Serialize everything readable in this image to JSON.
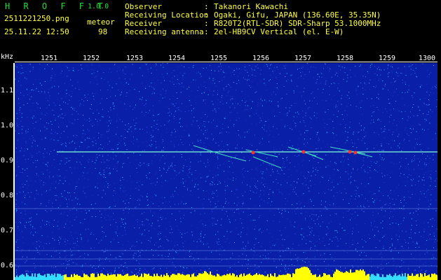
{
  "header": {
    "brand": "H R O F F T",
    "version": "1.0.0",
    "filename": "2511221250.png",
    "detector_label": "meteor",
    "datetime": "25.11.22 12:50",
    "meteor_count": "98",
    "info": [
      {
        "label": "Observer",
        "value": "Takanori Kawachi"
      },
      {
        "label": "Receiving Location",
        "value": "Ogaki, Gifu, JAPAN (136.60E, 35.35N)"
      },
      {
        "label": "Receiver",
        "value": "R820T2(RTL-SDR) SDR-Sharp 53.1000MHz"
      },
      {
        "label": "Receiving antenna",
        "value": "2el-HB9CV Vertical (el. E-W)"
      }
    ],
    "colon": ":"
  },
  "axes": {
    "y_unit": "kHz",
    "x_ticks": [
      "1251",
      "1252",
      "1253",
      "1254",
      "1255",
      "1256",
      "1257",
      "1258",
      "1259",
      "1300"
    ],
    "y_ticks": [
      "1.1",
      "1.0",
      "0.9",
      "0.8",
      "0.7",
      "0.6"
    ]
  },
  "colors": {
    "background": "#0a1fa8",
    "carrier": "#7fffd4",
    "echo_hot": "#ff3030",
    "bars": "#ffff00",
    "bars_low": "#33ddff"
  },
  "chart_data": {
    "type": "heatmap",
    "title": "",
    "xlabel": "",
    "ylabel": "kHz",
    "x_range": [
      "12:51",
      "13:00"
    ],
    "ylim": [
      0.58,
      1.2
    ],
    "carrier_khz": 0.92,
    "meteor_echo_times": [
      "12:55",
      "12:56",
      "12:57",
      "12:58"
    ],
    "grid": false
  }
}
